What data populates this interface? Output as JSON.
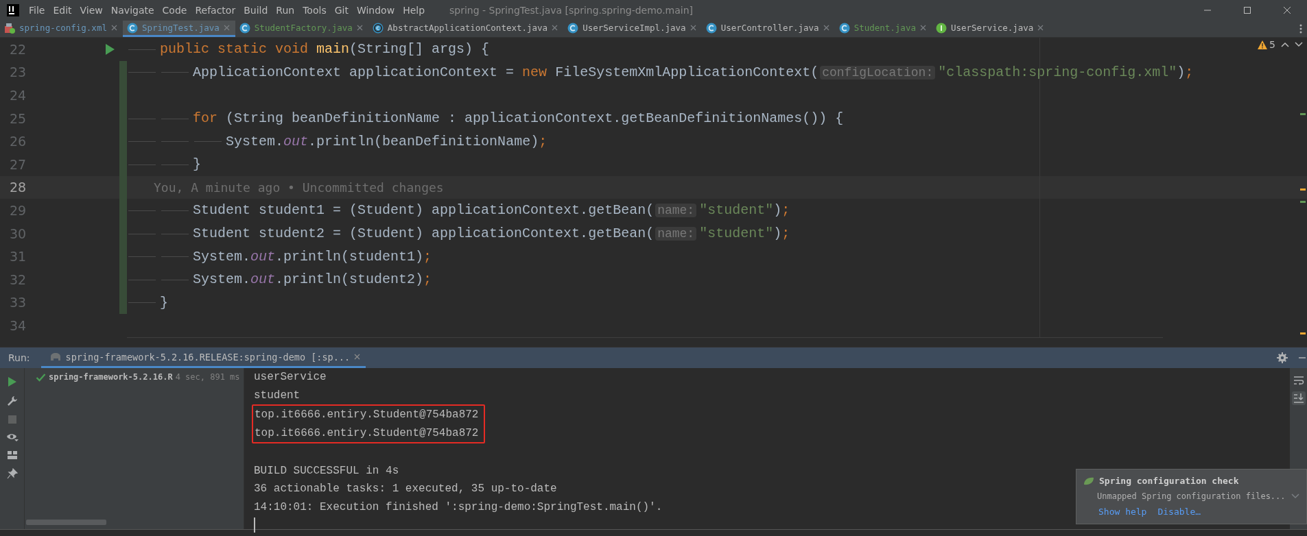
{
  "window": {
    "title": "spring - SpringTest.java [spring.spring-demo.main]",
    "menu": [
      "File",
      "Edit",
      "View",
      "Navigate",
      "Code",
      "Refactor",
      "Build",
      "Run",
      "Tools",
      "Git",
      "Window",
      "Help"
    ]
  },
  "tabs": [
    {
      "label": "spring-config.xml",
      "kind": "xml",
      "color": "#6897bb",
      "selected": false
    },
    {
      "label": "SpringTest.java",
      "kind": "class",
      "color": "#6897bb",
      "selected": true
    },
    {
      "label": "StudentFactory.java",
      "kind": "class",
      "color": "#629755",
      "selected": false
    },
    {
      "label": "AbstractApplicationContext.java",
      "kind": "abstract",
      "color": "#bbbbbb",
      "selected": false
    },
    {
      "label": "UserServiceImpl.java",
      "kind": "class",
      "color": "#bbbbbb",
      "selected": false
    },
    {
      "label": "UserController.java",
      "kind": "class",
      "color": "#bbbbbb",
      "selected": false
    },
    {
      "label": "Student.java",
      "kind": "class",
      "color": "#629755",
      "selected": false
    },
    {
      "label": "UserService.java",
      "kind": "interface",
      "color": "#bbbbbb",
      "selected": false
    }
  ],
  "editor": {
    "warnings": "5",
    "lines": [
      {
        "number": "22",
        "current": false,
        "changed": false,
        "run_marker": true,
        "tokens": [
          {
            "kind": "keyword",
            "text": "    public static void "
          },
          {
            "kind": "method",
            "text": "main"
          },
          {
            "kind": "plain",
            "text": "(String[] args) {"
          }
        ]
      },
      {
        "number": "23",
        "current": false,
        "changed": true,
        "run_marker": false,
        "tokens": [
          {
            "kind": "plain",
            "text": "        ApplicationContext applicationContext = "
          },
          {
            "kind": "keyword",
            "text": "new "
          },
          {
            "kind": "plain",
            "text": "FileSystemXmlApplicationContext("
          },
          {
            "kind": "hint",
            "text": "configLocation:"
          },
          {
            "kind": "string",
            "text": "\"classpath:spring-config.xml\""
          },
          {
            "kind": "plain",
            "text": ")"
          },
          {
            "kind": "keyword",
            "text": ";"
          }
        ]
      },
      {
        "number": "24",
        "current": false,
        "changed": true,
        "run_marker": false
      },
      {
        "number": "25",
        "current": false,
        "changed": true,
        "run_marker": false,
        "tokens": [
          {
            "kind": "keyword",
            "text": "        for "
          },
          {
            "kind": "plain",
            "text": "(String beanDefinitionName : applicationContext.getBeanDefinitionNames()) {"
          }
        ]
      },
      {
        "number": "26",
        "current": false,
        "changed": true,
        "run_marker": false,
        "tokens": [
          {
            "kind": "plain",
            "text": "            System."
          },
          {
            "kind": "field",
            "text": "out"
          },
          {
            "kind": "plain",
            "text": ".println(beanDefinitionName)"
          },
          {
            "kind": "keyword",
            "text": ";"
          }
        ]
      },
      {
        "number": "27",
        "current": false,
        "changed": true,
        "run_marker": false,
        "tokens": [
          {
            "kind": "plain",
            "text": "        }"
          }
        ]
      },
      {
        "number": "28",
        "current": true,
        "changed": true,
        "run_marker": false,
        "tokens": [
          {
            "kind": "annotation",
            "text": "You, A minute ago • Uncommitted changes"
          }
        ]
      },
      {
        "number": "29",
        "current": false,
        "changed": true,
        "run_marker": false,
        "tokens": [
          {
            "kind": "plain",
            "text": "        Student student1 = (Student) applicationContext.getBean("
          },
          {
            "kind": "hint",
            "text": "name:"
          },
          {
            "kind": "string",
            "text": "\"student\""
          },
          {
            "kind": "plain",
            "text": ")"
          },
          {
            "kind": "keyword",
            "text": ";"
          }
        ]
      },
      {
        "number": "30",
        "current": false,
        "changed": true,
        "run_marker": false,
        "tokens": [
          {
            "kind": "plain",
            "text": "        Student student2 = (Student) applicationContext.getBean("
          },
          {
            "kind": "hint",
            "text": "name:"
          },
          {
            "kind": "string",
            "text": "\"student\""
          },
          {
            "kind": "plain",
            "text": ")"
          },
          {
            "kind": "keyword",
            "text": ";"
          }
        ]
      },
      {
        "number": "31",
        "current": false,
        "changed": true,
        "run_marker": false,
        "tokens": [
          {
            "kind": "plain",
            "text": "        System."
          },
          {
            "kind": "field",
            "text": "out"
          },
          {
            "kind": "plain",
            "text": ".println(student1)"
          },
          {
            "kind": "keyword",
            "text": ";"
          }
        ]
      },
      {
        "number": "32",
        "current": false,
        "changed": true,
        "run_marker": false,
        "tokens": [
          {
            "kind": "plain",
            "text": "        System."
          },
          {
            "kind": "field",
            "text": "out"
          },
          {
            "kind": "plain",
            "text": ".println(student2)"
          },
          {
            "kind": "keyword",
            "text": ";"
          }
        ]
      },
      {
        "number": "33",
        "current": false,
        "changed": true,
        "run_marker": false,
        "tokens": [
          {
            "kind": "plain",
            "text": "    }"
          }
        ]
      },
      {
        "number": "34",
        "current": false,
        "changed": false,
        "run_marker": false
      }
    ]
  },
  "run_panel": {
    "label": "Run:",
    "tab": {
      "label": "spring-framework-5.2.16.RELEASE:spring-demo [:sp...",
      "selected": true
    },
    "tree": [
      {
        "label": "spring-framework-5.2.16.R",
        "duration": "4 sec, 891 ms",
        "passed": true
      }
    ],
    "console": [
      {
        "kind": "text",
        "text": "userService",
        "boxed": false
      },
      {
        "kind": "text",
        "text": "student",
        "boxed": false
      },
      {
        "kind": "text",
        "text": "top.it6666.entiry.Student@754ba872",
        "boxed": true
      },
      {
        "kind": "text",
        "text": "top.it6666.entiry.Student@754ba872",
        "boxed": true
      },
      {
        "kind": "blank"
      },
      {
        "kind": "text",
        "text": "BUILD SUCCESSFUL in 4s",
        "boxed": false
      },
      {
        "kind": "text",
        "text": "36 actionable tasks: 1 executed, 35 up-to-date",
        "boxed": false
      },
      {
        "kind": "text",
        "text": "14:10:01: Execution finished ':spring-demo:SpringTest.main()'.",
        "boxed": false
      },
      {
        "kind": "cursor"
      }
    ]
  },
  "notification": {
    "title": "Spring configuration check",
    "message": "Unmapped Spring configuration files...",
    "actions": [
      "Show help",
      "Disable…"
    ]
  }
}
